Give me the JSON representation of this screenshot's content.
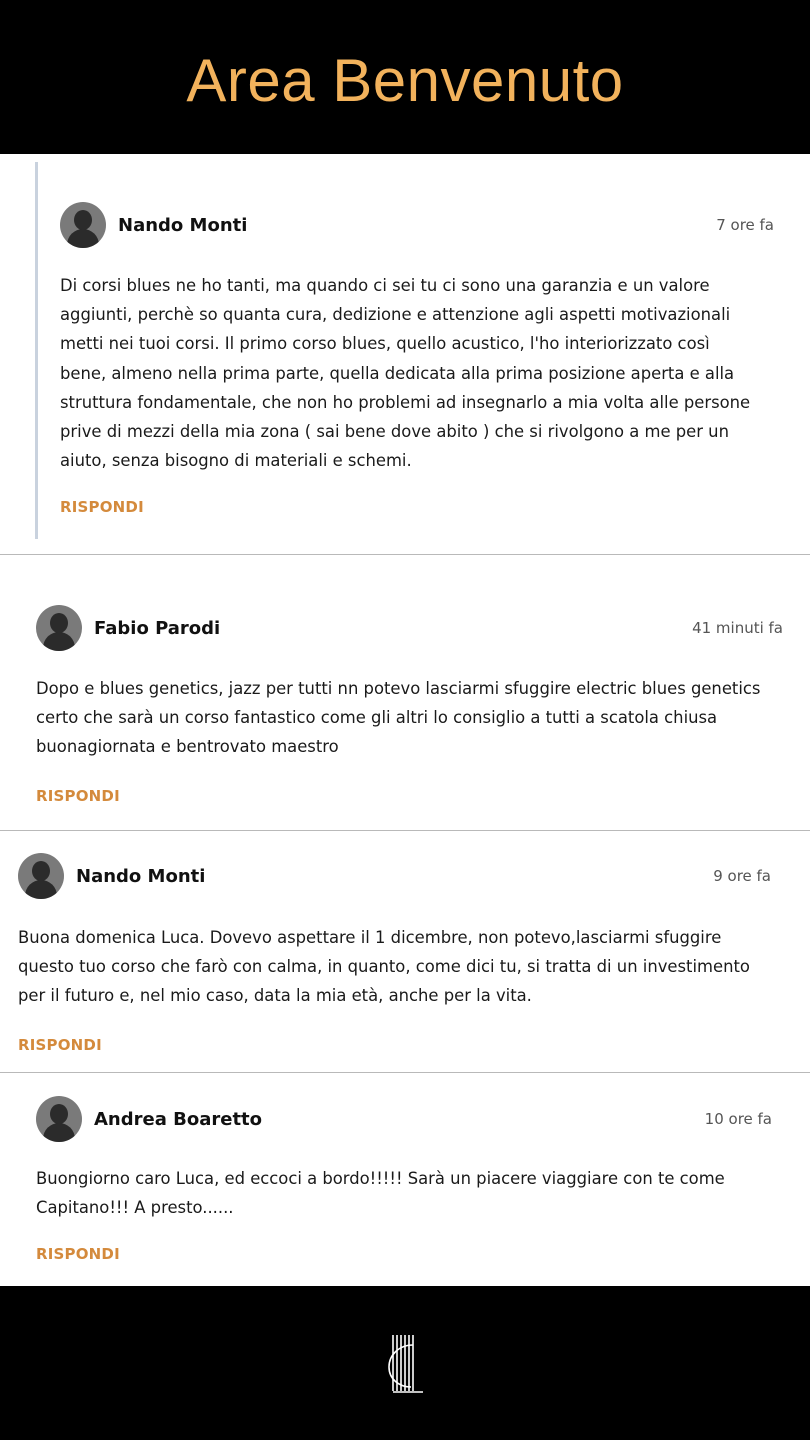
{
  "header": {
    "title": "Area Benvenuto"
  },
  "comments": [
    {
      "author": "Nando Monti",
      "time": "7 ore fa",
      "text": "Di corsi blues ne ho tanti, ma quando ci sei tu ci sono una garanzia e un valore aggiunti, perchè so quanta cura, dedizione e attenzione agli aspetti motivazionali metti nei tuoi corsi. Il primo corso blues, quello acustico, l'ho interiorizzato così bene, almeno nella prima parte, quella dedicata alla prima posizione aperta e alla struttura fondamentale, che non ho problemi ad insegnarlo a mia volta alle persone prive di mezzi della mia zona ( sai bene dove abito ) che si rivolgono a me per un aiuto, senza bisogno di materiali e schemi.",
      "reply_label": "RISPONDI"
    },
    {
      "author": "Fabio Parodi",
      "time": "41 minuti fa",
      "text": "Dopo e blues genetics, jazz per tutti nn potevo lasciarmi sfuggire electric blues genetics certo che sarà un corso fantastico come gli altri lo consiglio a tutti a scatola chiusa buonagiornata e bentrovato maestro",
      "reply_label": "RISPONDI"
    },
    {
      "author": "Nando Monti",
      "time": "9 ore fa",
      "text": "Buona domenica Luca. Dovevo aspettare il 1 dicembre, non potevo,lasciarmi sfuggire questo tuo corso che farò con calma, in quanto, come dici tu, si tratta di un investimento per il futuro e, nel mio caso, data la mia età, anche per la vita.",
      "reply_label": "RISPONDI"
    },
    {
      "author": "Andrea Boaretto",
      "time": "10 ore fa",
      "text": "Buongiorno caro Luca, ed eccoci a bordo!!!!! Sarà un piacere viaggiare con te come Capitano!!! A presto......",
      "reply_label": "RISPONDI"
    }
  ],
  "footer": {
    "logo_icon": "harp-logo-icon"
  },
  "colors": {
    "accent_title": "#f2b25c",
    "reply": "#d48a3c",
    "background": "#000000"
  }
}
